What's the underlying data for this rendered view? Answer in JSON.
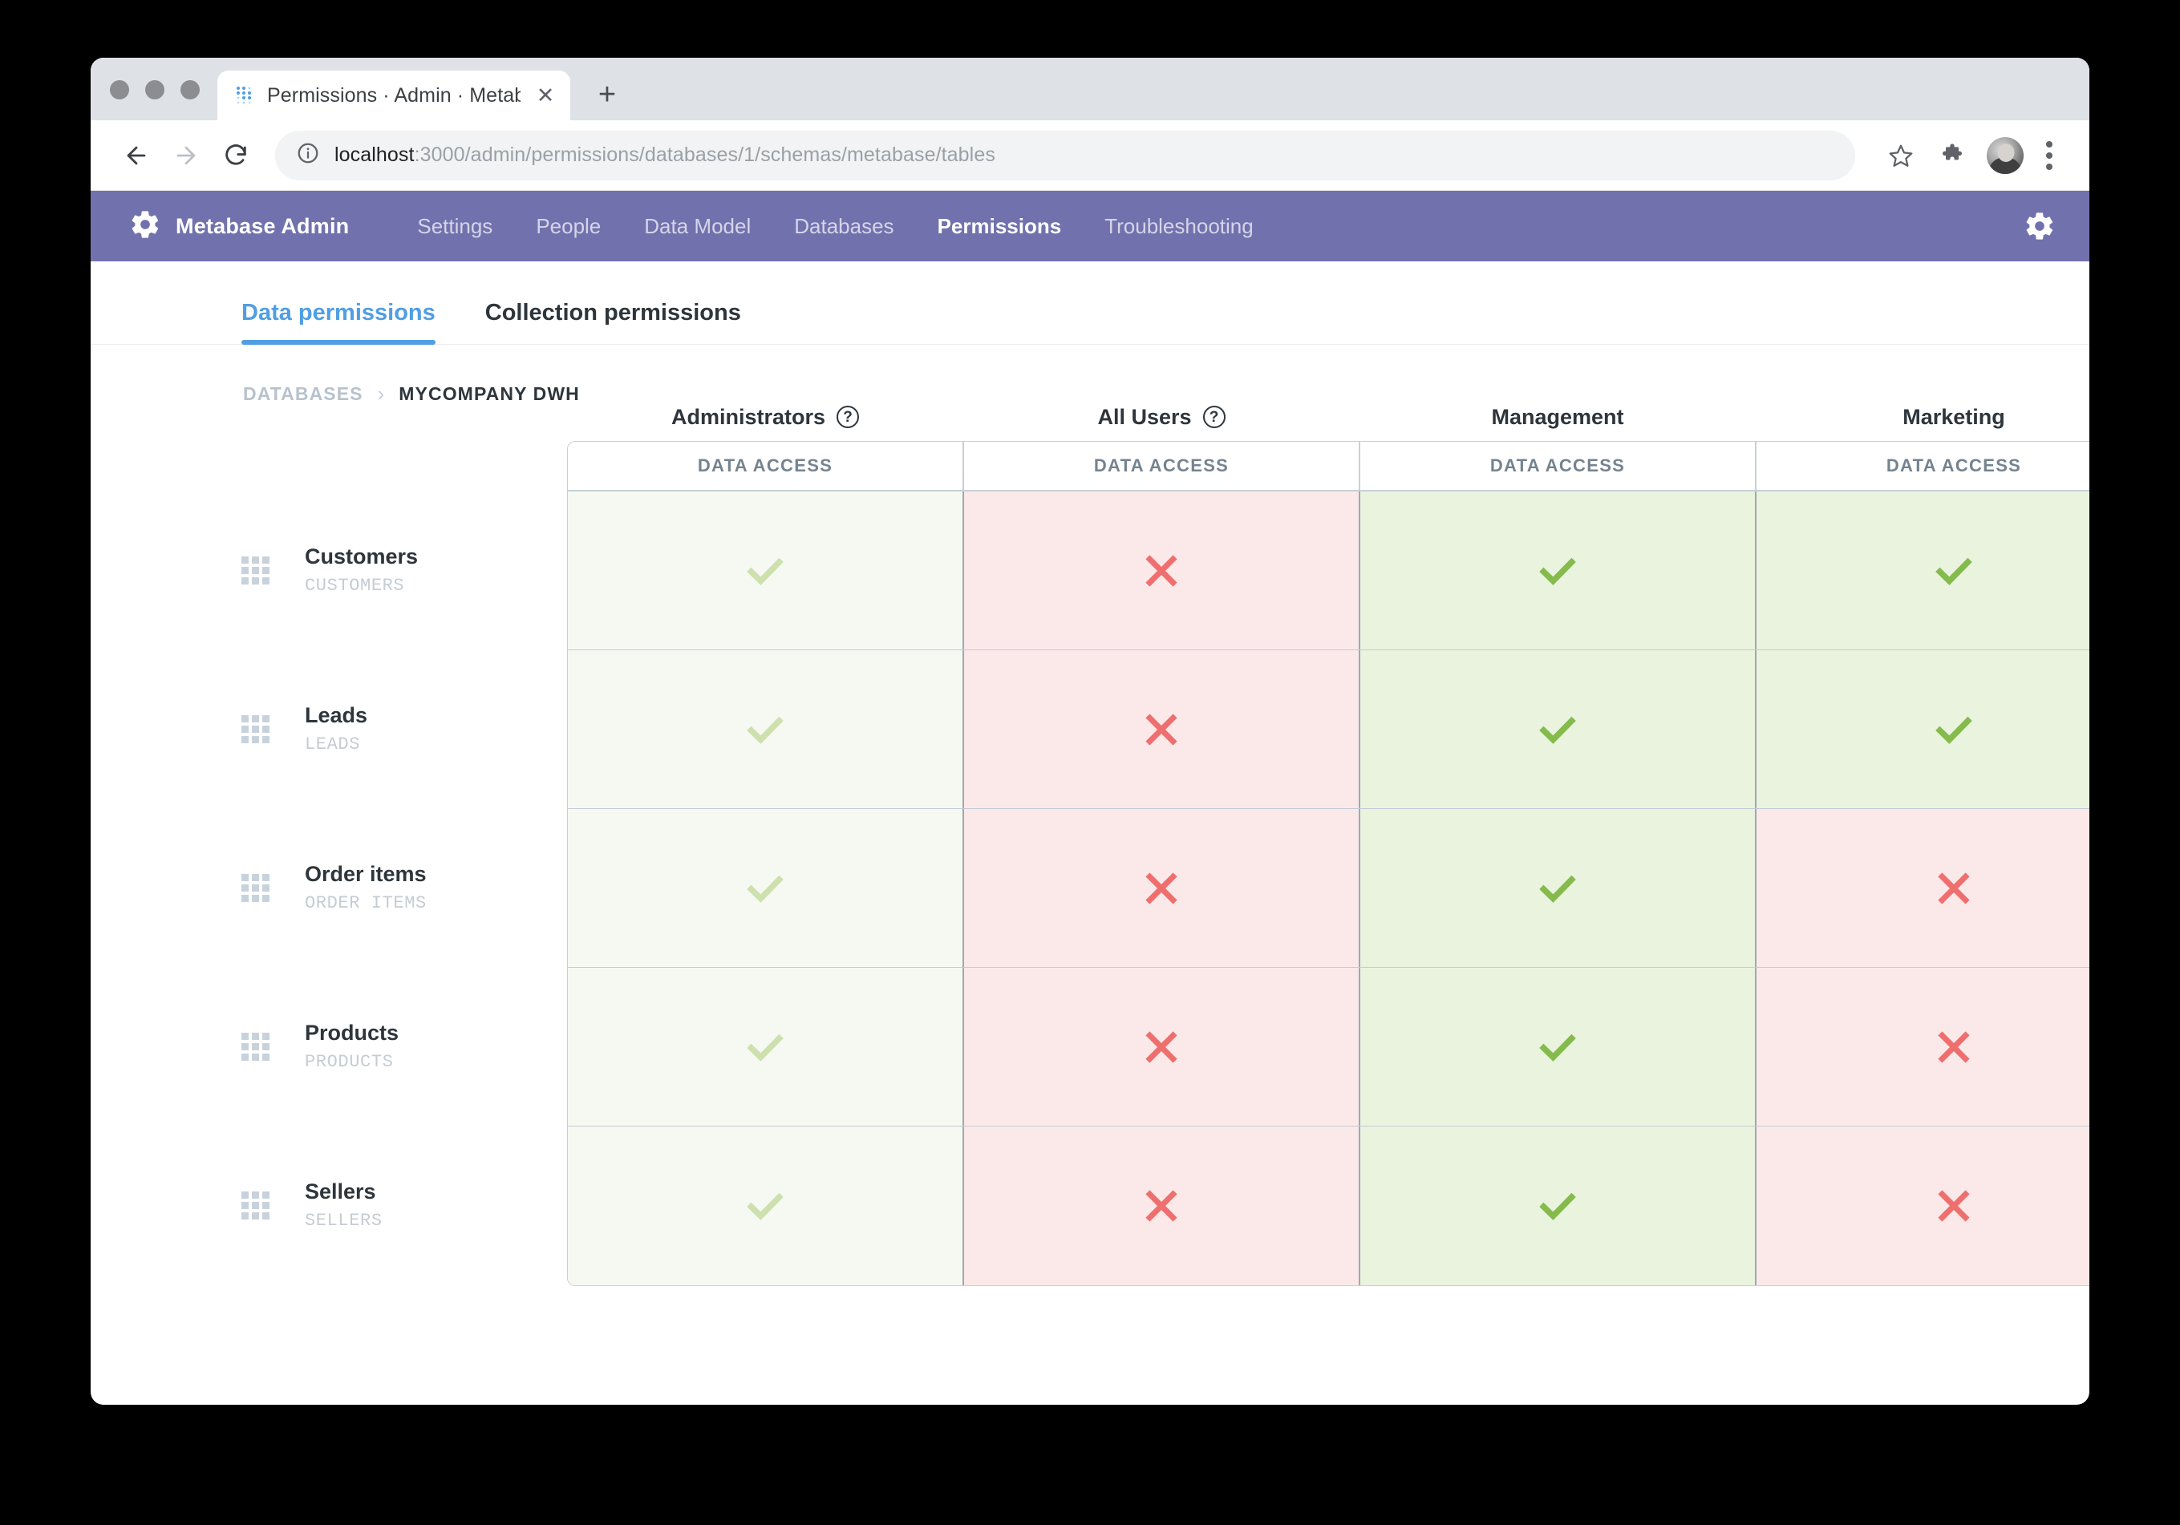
{
  "browser": {
    "tab": {
      "title": "Permissions · Admin · Metabas",
      "favicon_icon": "metabase-dots-favicon",
      "close_icon": "close-icon"
    },
    "new_tab_icon": "plus-icon",
    "back_icon": "back-arrow-icon",
    "forward_icon": "forward-arrow-icon",
    "reload_icon": "reload-icon",
    "info_icon": "info-circle-icon",
    "url": {
      "host": "localhost",
      "path": ":3000/admin/permissions/databases/1/schemas/metabase/tables",
      "full": "localhost:3000/admin/permissions/databases/1/schemas/metabase/tables"
    },
    "bookmark_icon": "star-icon",
    "extensions_icon": "puzzle-icon",
    "profile_icon": "avatar",
    "menu_icon": "kebab-menu-icon"
  },
  "admin_nav": {
    "logo_icon": "gear-logo-icon",
    "brand": "Metabase Admin",
    "links": [
      {
        "label": "Settings",
        "active": false
      },
      {
        "label": "People",
        "active": false
      },
      {
        "label": "Data Model",
        "active": false
      },
      {
        "label": "Databases",
        "active": false
      },
      {
        "label": "Permissions",
        "active": true
      },
      {
        "label": "Troubleshooting",
        "active": false
      }
    ],
    "settings_icon": "gear-icon",
    "background_color": "#7172AD"
  },
  "page_tabs": [
    {
      "label": "Data permissions",
      "active": true
    },
    {
      "label": "Collection permissions",
      "active": false
    }
  ],
  "breadcrumb": {
    "root": "DATABASES",
    "separator": "›",
    "current": "MYCOMPANY DWH"
  },
  "permissions": {
    "groups": [
      {
        "name": "Administrators",
        "has_help": true,
        "help_glyph": "?",
        "subheader": "DATA ACCESS"
      },
      {
        "name": "All Users",
        "has_help": true,
        "help_glyph": "?",
        "subheader": "DATA ACCESS"
      },
      {
        "name": "Management",
        "has_help": false,
        "help_glyph": "?",
        "subheader": "DATA ACCESS"
      },
      {
        "name": "Marketing",
        "has_help": false,
        "help_glyph": "?",
        "subheader": "DATA ACCESS"
      }
    ],
    "tables": [
      {
        "name": "Customers",
        "schema_name": "CUSTOMERS",
        "icon": "table-grid-icon"
      },
      {
        "name": "Leads",
        "schema_name": "LEADS",
        "icon": "table-grid-icon"
      },
      {
        "name": "Order items",
        "schema_name": "ORDER ITEMS",
        "icon": "table-grid-icon"
      },
      {
        "name": "Products",
        "schema_name": "PRODUCTS",
        "icon": "table-grid-icon"
      },
      {
        "name": "Sellers",
        "schema_name": "SELLERS",
        "icon": "table-grid-icon"
      }
    ],
    "matrix": [
      [
        "allow-muted",
        "deny",
        "allow",
        "allow"
      ],
      [
        "allow-muted",
        "deny",
        "allow",
        "allow"
      ],
      [
        "allow-muted",
        "deny",
        "allow",
        "deny"
      ],
      [
        "allow-muted",
        "deny",
        "allow",
        "deny"
      ],
      [
        "allow-muted",
        "deny",
        "allow",
        "deny"
      ]
    ],
    "state_icons": {
      "allow": "check-icon",
      "allow-muted": "check-icon",
      "deny": "cross-icon"
    },
    "colors": {
      "allow_bg": "#EAF3DE",
      "allow_muted_bg": "#F6F9F2",
      "deny_bg": "#FBE9E9",
      "check": "#84BB4C",
      "check_muted": "#CDE0AE",
      "cross": "#EF6E6E",
      "accent": "#509EE3"
    }
  }
}
